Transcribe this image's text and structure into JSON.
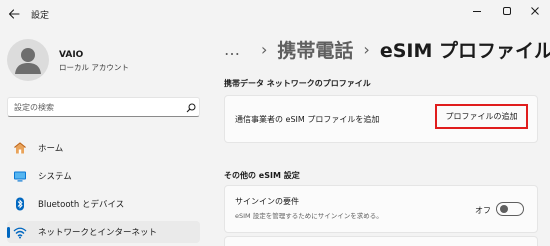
{
  "window": {
    "title": "設定"
  },
  "user": {
    "name": "VAIO",
    "account_type": "ローカル アカウント"
  },
  "search": {
    "placeholder": "設定の検索"
  },
  "sidebar": {
    "items": [
      {
        "label": "ホーム",
        "icon": "home-icon"
      },
      {
        "label": "システム",
        "icon": "system-icon"
      },
      {
        "label": "Bluetooth とデバイス",
        "icon": "bluetooth-icon"
      },
      {
        "label": "ネットワークとインターネット",
        "icon": "network-icon",
        "active": true
      }
    ]
  },
  "breadcrumb": {
    "overflow": "…",
    "parent": "携帯電話",
    "current": "eSIM プロファイル"
  },
  "profiles_section": {
    "title": "携帯データ ネットワークのプロファイル",
    "add_label": "通信事業者の eSIM プロファイルを追加",
    "add_button": "プロファイルの追加"
  },
  "other_section": {
    "title": "その他の eSIM 設定",
    "signin_label": "サインインの要件",
    "signin_desc": "eSIM 設定を管理するためにサインインを求める。",
    "signin_state": "オフ"
  },
  "colors": {
    "accent": "#0067c0",
    "highlight_border": "#e01d1d",
    "background": "#f3f3f3"
  }
}
